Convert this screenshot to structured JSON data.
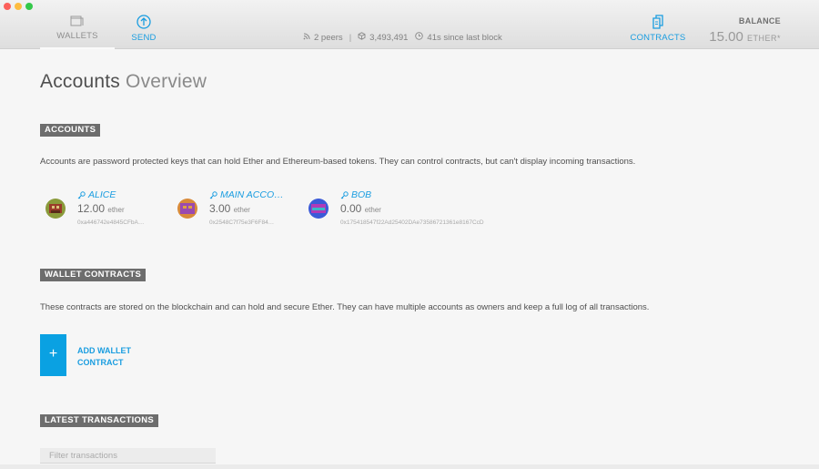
{
  "nav": {
    "wallets_label": "WALLETS",
    "send_label": "SEND",
    "contracts_label": "CONTRACTS"
  },
  "status": {
    "peers": "2 peers",
    "block": "3,493,491",
    "since": "41s since last block"
  },
  "balance": {
    "label": "BALANCE",
    "value": "15.00",
    "unit": "ETHER*"
  },
  "page_title": {
    "strong": "Accounts",
    "light": "Overview"
  },
  "accounts_section": {
    "tag": "ACCOUNTS",
    "description": "Accounts are password protected keys that can hold Ether and Ethereum-based tokens. They can control contracts, but can't display incoming transactions.",
    "items": [
      {
        "name": "ALICE",
        "amount": "12.00",
        "unit": "ether",
        "address": "0xa446742e4845CFbA…"
      },
      {
        "name": "MAIN ACCO…",
        "amount": "3.00",
        "unit": "ether",
        "address": "0x2548C7f75e3F6F84…"
      },
      {
        "name": "BOB",
        "amount": "0.00",
        "unit": "ether",
        "address": "0x175418547f22Ad25402DAe73586721361e8167CcD"
      }
    ]
  },
  "wallet_section": {
    "tag": "WALLET CONTRACTS",
    "description": "These contracts are stored on the blockchain and can hold and secure Ether. They can have multiple accounts as owners and keep a full log of all transactions.",
    "add_symbol": "+",
    "add_line1": "ADD WALLET",
    "add_line2": "CONTRACT"
  },
  "transactions_section": {
    "tag": "LATEST TRANSACTIONS",
    "filter_placeholder": "Filter transactions"
  },
  "colors": {
    "accent": "#1a9de0",
    "add_button": "#0aa1e2",
    "tag_bg": "#6d6d6d"
  }
}
